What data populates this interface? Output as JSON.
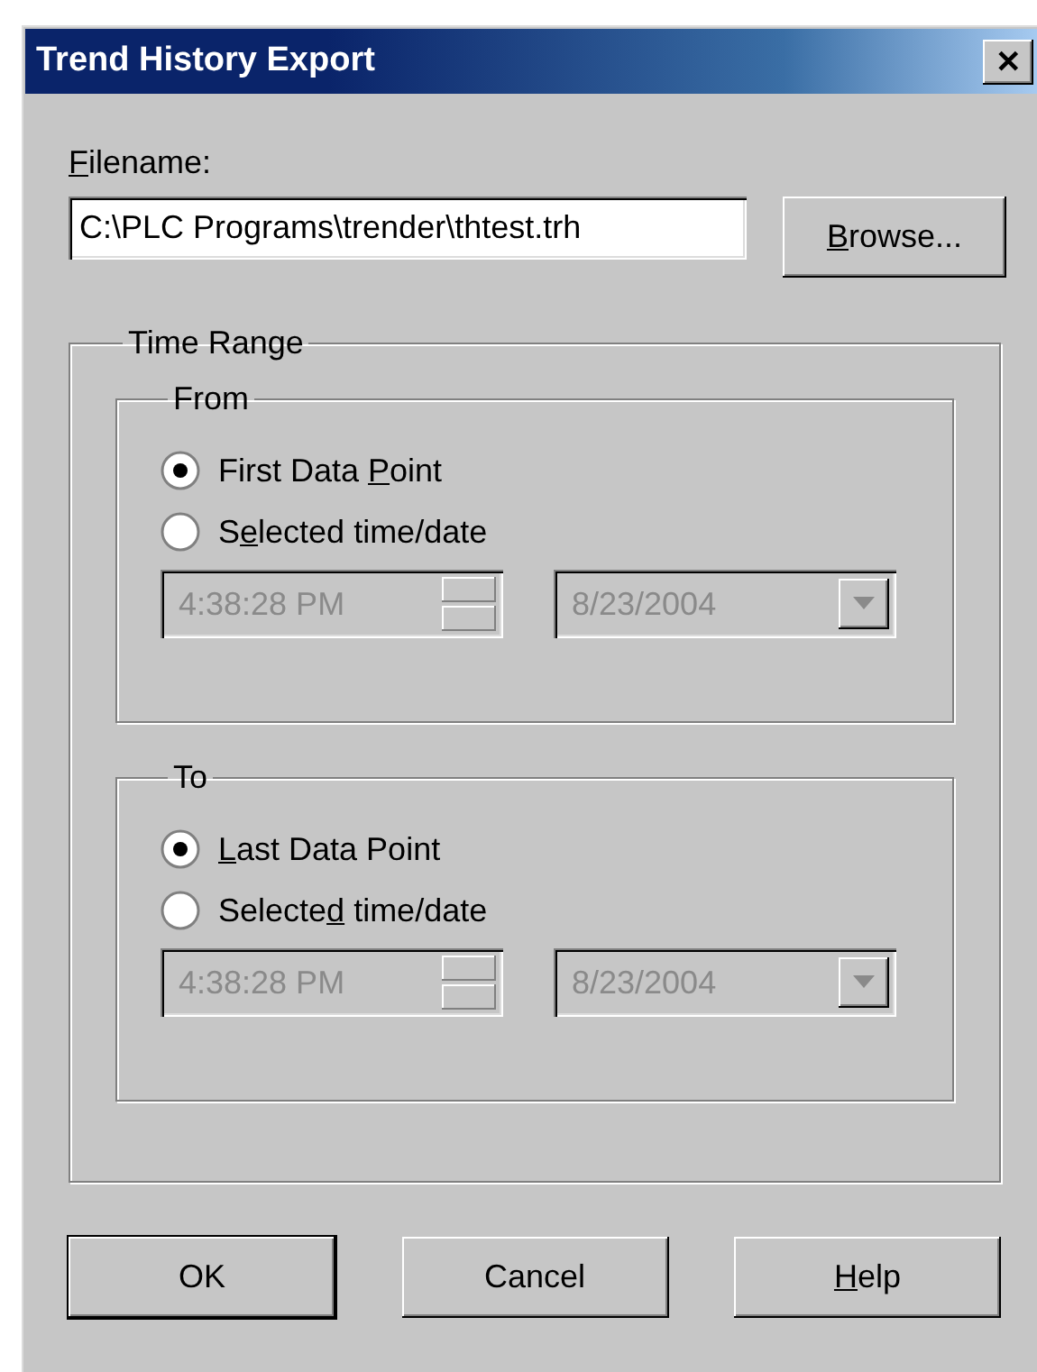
{
  "window": {
    "title": "Trend History Export",
    "close": "✕"
  },
  "filename": {
    "label": {
      "key": "F",
      "post": "ilename:"
    },
    "value": "C:\\PLC Programs\\trender\\thtest.trh"
  },
  "browse_button": {
    "label": {
      "key": "B",
      "post": "rowse..."
    }
  },
  "time_range": {
    "title": "Time Range",
    "groups": [
      {
        "title": "From",
        "options": [
          {
            "label": {
              "pre": "First Data ",
              "key": "P",
              "post": "oint"
            },
            "selected": true
          },
          {
            "label": {
              "pre": "S",
              "key": "e",
              "post": "lected time/date"
            },
            "selected": false
          }
        ],
        "time": {
          "value": "4:38:28 PM",
          "disabled": true
        },
        "date": {
          "value": "8/23/2004",
          "disabled": true
        }
      },
      {
        "title": "To",
        "options": [
          {
            "label": {
              "key": "L",
              "post": "ast Data Point"
            },
            "selected": true
          },
          {
            "label": {
              "pre": "Selecte",
              "key": "d",
              "post": " time/date"
            },
            "selected": false
          }
        ],
        "time": {
          "value": "4:38:28 PM",
          "disabled": true
        },
        "date": {
          "value": "8/23/2004",
          "disabled": true
        }
      }
    ]
  },
  "buttons": [
    {
      "label": {
        "post": "OK"
      },
      "default": true
    },
    {
      "label": {
        "post": "Cancel"
      },
      "default": false
    },
    {
      "label": {
        "key": "H",
        "post": "elp"
      },
      "default": false
    }
  ]
}
